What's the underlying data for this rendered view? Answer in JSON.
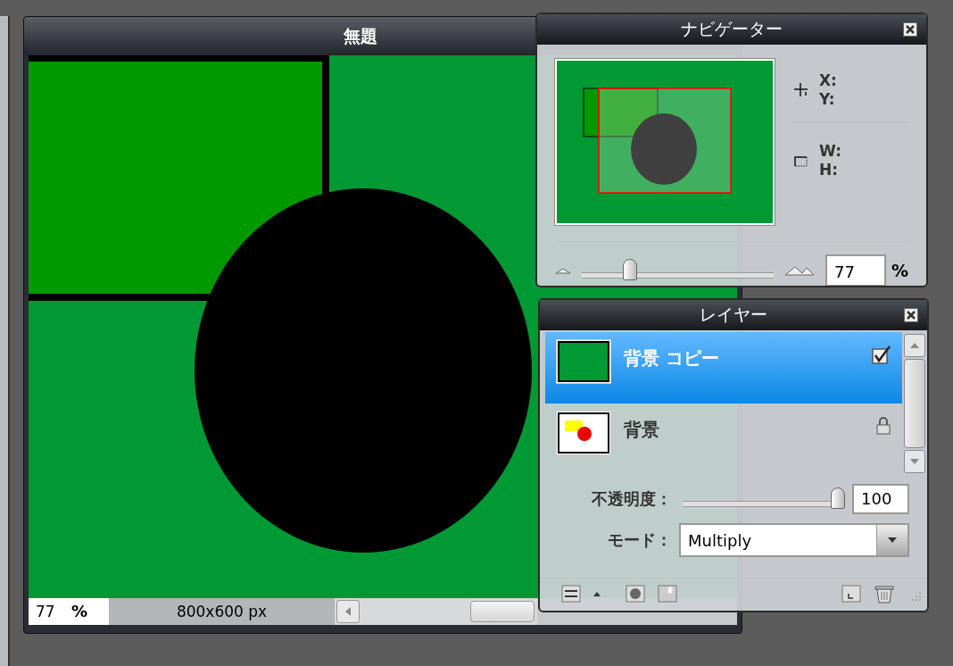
{
  "document": {
    "title": "無題",
    "zoom": "77",
    "zoom_unit": "%",
    "size": "800x600 px"
  },
  "navigator": {
    "title": "ナビゲーター",
    "x_label": "X:",
    "y_label": "Y:",
    "w_label": "W:",
    "h_label": "H:",
    "zoom_slider": {
      "level": 0.23
    },
    "zoom_value": "77",
    "zoom_unit": "%"
  },
  "layers": {
    "title": "レイヤー",
    "items": [
      {
        "name": "背景 コピー",
        "selected": true,
        "thumbnail": {
          "kind": "fill"
        },
        "kind": "checkbox",
        "checked": true
      },
      {
        "name": "背景",
        "selected": false,
        "thumbnail": {
          "kind": "shapes"
        },
        "kind": "lock"
      }
    ],
    "opacity_label": "不透明度：",
    "opacity_slider": {
      "level": 1
    },
    "opacity_value": "100",
    "mode_label": "モード：",
    "mode_value": "Multiply"
  }
}
